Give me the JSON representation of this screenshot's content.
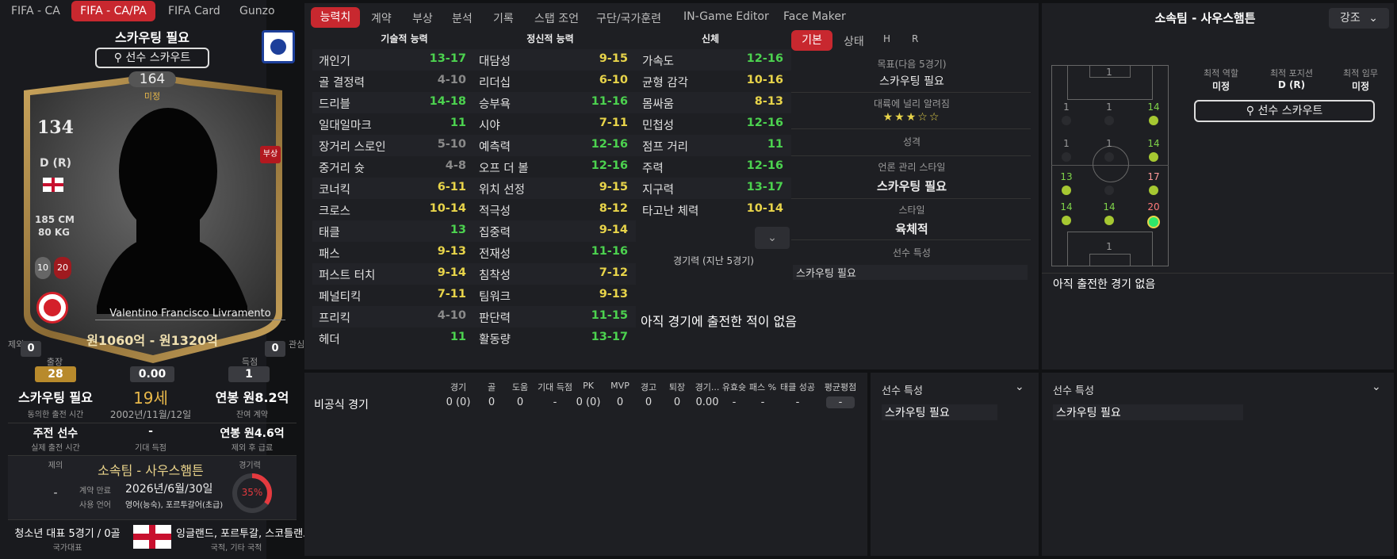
{
  "top_tabs": [
    "FIFA - CA",
    "FIFA - CA/PA",
    "FIFA Card",
    "Gunzo"
  ],
  "card": {
    "status": "스카우팅 필요",
    "scout_button": "선수 스카우트",
    "number": "164",
    "number_sub": "미정",
    "rating": "134",
    "position": "D (R)",
    "height": "185 CM",
    "weight": "80 KG",
    "badge_left": "10",
    "badge_right": "20",
    "injury": "부상",
    "player_name": "Valentino Francisco Livramento",
    "value": "원1060억 - 원1320억"
  },
  "side_left": {
    "label": "제외",
    "val": "0"
  },
  "side_right": {
    "label": "관심",
    "val": "0"
  },
  "stats_row": {
    "apps_label": "출장",
    "apps": "28",
    "avg": "0.00",
    "goals_label": "득점",
    "goals": "1"
  },
  "bio": {
    "col1_main": "스카우팅 필요",
    "col1_sub": "동의한 출전 시간",
    "age": "19세",
    "dob": "2002년/11월/12일",
    "col3_main": "연봉 원8.2억",
    "col3_sub": "잔여 계약",
    "r2c1_main": "주전 선수",
    "r2c1_sub": "실제 출전 시간",
    "r2c2_main": "-",
    "r2c2_sub": "기대 득점",
    "r2c3_main": "연봉 원4.6억",
    "r2c3_sub": "제외 후 급료"
  },
  "contract": {
    "left_label": "제의",
    "left_val": "-",
    "club": "소속팀 - 사우스햄튼",
    "expiry_label": "계약 만료",
    "expiry": "2026년/6월/30일",
    "lang_label": "사용 언어",
    "lang": "영어(능숙), 포르투갈어(초급)",
    "exp_label": "경기력",
    "exp_pct": "35%",
    "exp_value": 35
  },
  "national": {
    "caps": "청소년 대표 5경기 / 0골",
    "caps_sub": "국가대표",
    "nations": "잉글랜드, 포르투갈, 스코틀랜드",
    "nations_sub": "국적, 기타 국적"
  },
  "main_tabs": [
    "능력치",
    "계약",
    "부상",
    "분석",
    "기록",
    "스탭 조언",
    "구단/국가훈련",
    "IN-Game Editor",
    "Face Maker"
  ],
  "headers": {
    "tech": "기술적 능력",
    "mental": "정신적 능력",
    "physical": "신체"
  },
  "technical": [
    {
      "n": "개인기",
      "v": "13-17",
      "c": "green"
    },
    {
      "n": "골 결정력",
      "v": "4-10",
      "c": "grey"
    },
    {
      "n": "드리블",
      "v": "14-18",
      "c": "green"
    },
    {
      "n": "일대일마크",
      "v": "11",
      "c": "green"
    },
    {
      "n": "장거리 스로인",
      "v": "5-10",
      "c": "grey"
    },
    {
      "n": "중거리 슛",
      "v": "4-8",
      "c": "grey"
    },
    {
      "n": "코너킥",
      "v": "6-11",
      "c": "yellow"
    },
    {
      "n": "크로스",
      "v": "10-14",
      "c": "yellow"
    },
    {
      "n": "태클",
      "v": "13",
      "c": "green"
    },
    {
      "n": "패스",
      "v": "9-13",
      "c": "yellow"
    },
    {
      "n": "퍼스트 터치",
      "v": "9-14",
      "c": "yellow"
    },
    {
      "n": "페널티킥",
      "v": "7-11",
      "c": "yellow"
    },
    {
      "n": "프리킥",
      "v": "4-10",
      "c": "grey"
    },
    {
      "n": "헤더",
      "v": "11",
      "c": "green"
    }
  ],
  "mental": [
    {
      "n": "대담성",
      "v": "9-15",
      "c": "yellow"
    },
    {
      "n": "리더십",
      "v": "6-10",
      "c": "yellow"
    },
    {
      "n": "승부욕",
      "v": "11-16",
      "c": "green"
    },
    {
      "n": "시야",
      "v": "7-11",
      "c": "yellow"
    },
    {
      "n": "예측력",
      "v": "12-16",
      "c": "green"
    },
    {
      "n": "오프 더 볼",
      "v": "12-16",
      "c": "green"
    },
    {
      "n": "위치 선정",
      "v": "9-15",
      "c": "yellow"
    },
    {
      "n": "적극성",
      "v": "8-12",
      "c": "yellow"
    },
    {
      "n": "집중력",
      "v": "9-14",
      "c": "yellow"
    },
    {
      "n": "전재성",
      "v": "11-16",
      "c": "green"
    },
    {
      "n": "침착성",
      "v": "7-12",
      "c": "yellow"
    },
    {
      "n": "팀워크",
      "v": "9-13",
      "c": "yellow"
    },
    {
      "n": "판단력",
      "v": "11-15",
      "c": "green"
    },
    {
      "n": "활동량",
      "v": "13-17",
      "c": "green"
    }
  ],
  "physical": [
    {
      "n": "가속도",
      "v": "12-16",
      "c": "green"
    },
    {
      "n": "균형 감각",
      "v": "10-16",
      "c": "yellow"
    },
    {
      "n": "몸싸움",
      "v": "8-13",
      "c": "yellow"
    },
    {
      "n": "민첩성",
      "v": "12-16",
      "c": "green"
    },
    {
      "n": "점프 거리",
      "v": "11",
      "c": "green"
    },
    {
      "n": "주력",
      "v": "12-16",
      "c": "green"
    },
    {
      "n": "지구력",
      "v": "13-17",
      "c": "green"
    },
    {
      "n": "타고난 체력",
      "v": "10-14",
      "c": "yellow"
    }
  ],
  "form": {
    "label": "경기력 (지난 5경기)",
    "none": "아직 경기에 출전한 적이 없음"
  },
  "info_tabs": [
    "기본",
    "상태",
    "H",
    "R"
  ],
  "info": {
    "goal_label": "목표(다음 5경기)",
    "goal": "스카우팅 필요",
    "fame_label": "대륙에 널리 알려짐",
    "stars": "★★★☆☆",
    "personality_label": "성격",
    "media_label": "언론 관리 스타일",
    "media": "스카우팅 필요",
    "style_label": "스타일",
    "style": "육체적",
    "traits_label": "선수 특성",
    "traits": "스카우팅 필요"
  },
  "right_panel": {
    "title": "소속팀 - 사우스햄튼",
    "dropdown": "강조",
    "best_role_label": "최적 역할",
    "best_role": "미정",
    "best_pos_label": "최적 포지션",
    "best_pos": "D (R)",
    "best_duty_label": "최적 임무",
    "best_duty": "미정",
    "scout_button": "선수 스카우트",
    "no_games": "아직 출전한 경기 없음",
    "pitch": {
      "gk_top": "1",
      "gk_bot": "1",
      "r1": [
        "1",
        "1",
        "14"
      ],
      "r2": [
        "1",
        "1",
        "14"
      ],
      "r3": [
        "13",
        "",
        "17"
      ],
      "r4": [
        "14",
        "14",
        "20"
      ]
    }
  },
  "bottom": {
    "headers": [
      "경기",
      "골",
      "도움",
      "기대 득점",
      "PK",
      "MVP",
      "경고",
      "퇴장",
      "경기...",
      "유효슛",
      "패스 %",
      "태클 성공",
      "평균평점"
    ],
    "row_label": "비공식 경기",
    "row": [
      "0 (0)",
      "0",
      "0",
      "-",
      "0 (0)",
      "0",
      "0",
      "0",
      "0.00",
      "-",
      "-",
      "-",
      "-"
    ],
    "traits1_title": "선수 특성",
    "traits1_val": "스카우팅 필요",
    "traits2_title": "선수 특성",
    "traits2_val": "스카우팅 필요"
  }
}
